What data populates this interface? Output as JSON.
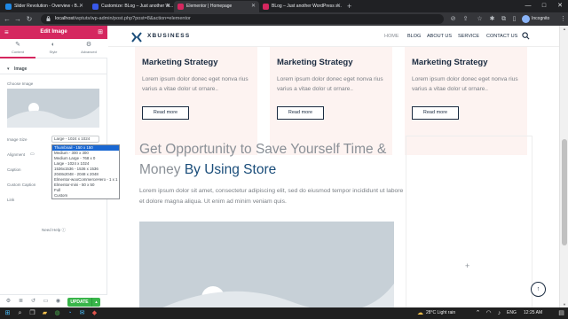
{
  "browser": {
    "tabs": [
      {
        "label": "Slider Revolution - Overview ‹ B...",
        "color": "#1e88e5",
        "active": false
      },
      {
        "label": "Customize: BLog – Just another W...",
        "color": "#3858e9",
        "active": false
      },
      {
        "label": "Elementor | Homepage",
        "color": "#d5275f",
        "active": true
      },
      {
        "label": "BLog – Just another WordPress s...",
        "color": "#d5275f",
        "active": false
      }
    ],
    "new_tab": "+",
    "window_controls": [
      "—",
      "□",
      "✕"
    ],
    "url_host": "localhost",
    "url_path": "/wptuts/wp-admin/post.php?post=8&action=elementor",
    "profile_label": "Incognito"
  },
  "panel": {
    "title": "Edit Image",
    "tabs": [
      {
        "label": "Content",
        "icon": "pencil-icon"
      },
      {
        "label": "Style",
        "icon": "half-circle-icon"
      },
      {
        "label": "Advanced",
        "icon": "gear-icon"
      }
    ],
    "section": "Image",
    "choose_image": "Choose Image",
    "image_size_label": "Image Size",
    "image_size_value": "Large - 1024 x 1024",
    "alignment_label": "Alignment",
    "caption_label": "Caption",
    "custom_caption_label": "Custom Caption",
    "link_label": "Link",
    "need_help": "Need Help",
    "update": "UPDATE",
    "size_options": [
      "Thumbnail - 150 x 150",
      "Medium - 300 x 300",
      "Medium Large - 768 x 0",
      "Large - 1024 x 1024",
      "1536x1536 - 1536 x 1536",
      "2048x2048 - 2048 x 2048",
      "Elmentor-wooCommerceHero - 1 x 1",
      "Elmentor-mini - 50 x 50",
      "Full",
      "Custom"
    ],
    "selected_option_index": 0
  },
  "site": {
    "logo_text": "XBUSINESS",
    "nav": [
      "HOME",
      "BLOG",
      "ABOUT US",
      "SERVICE",
      "CONTACT US"
    ],
    "nav_active_index": 0,
    "cards": [
      {
        "title": "Marketing Strategy",
        "body": "Lorem ipsum dolor donec eget nonva rius varius a vitae dolor ut ornare..",
        "button": "Read more"
      },
      {
        "title": "Marketing Strategy",
        "body": "Lorem ipsum dolor donec eget nonva rius varius a vitae dolor ut ornare..",
        "button": "Read more"
      },
      {
        "title": "Marketing Strategy",
        "body": "Lorem ipsum dolor donec eget nonva rius varius a vitae dolor ut ornare..",
        "button": "Read more"
      }
    ],
    "heading_part1": "Get Opportunity to Save Yourself Time & Money ",
    "heading_highlight": "By Using Store",
    "paragraph": "Lorem ipsum dolor sit amet, consectetur adipiscing elit, sed do eiusmod tempor incididunt ut labore et dolore magna aliqua. Ut enim ad minim veniam quis.",
    "add_icon": "+",
    "back_to_top_icon": "↑"
  },
  "taskbar": {
    "weather": "28°C  Light rain",
    "language": "ENG",
    "time": "12:25 AM"
  },
  "colors": {
    "elementor": "#d5275f",
    "card_bg": "#fdf3f1",
    "navy": "#1a2b40",
    "update_green": "#39b54a"
  }
}
